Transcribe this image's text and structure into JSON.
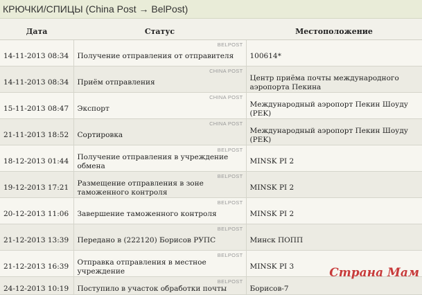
{
  "header": {
    "title": "КРЮЧКИ/СПИЦЫ (China Post → BelPost)"
  },
  "table": {
    "columns": [
      "Дата",
      "Статус",
      "Местоположение"
    ],
    "rows": [
      {
        "date": "14-11-2013 08:34",
        "service": "BELPOST",
        "status": "Получение отправления от отправителя",
        "location": "100614*"
      },
      {
        "date": "14-11-2013 08:34",
        "service": "CHINA POST",
        "status": "Приём отправления",
        "location": "Центр приёма почты международного аэропорта Пекина"
      },
      {
        "date": "15-11-2013 08:47",
        "service": "CHINA POST",
        "status": "Экспорт",
        "location": "Международный аэропорт Пекин Шоуду (PEK)"
      },
      {
        "date": "21-11-2013 18:52",
        "service": "CHINA POST",
        "status": "Сортировка",
        "location": "Международный аэропорт Пекин Шоуду (PEK)"
      },
      {
        "date": "18-12-2013 01:44",
        "service": "BELPOST",
        "status": "Получение отправления в учреждение обмена",
        "location": "MINSK PI 2"
      },
      {
        "date": "19-12-2013 17:21",
        "service": "BELPOST",
        "status": "Размещение отправления в зоне таможенного контроля",
        "location": "MINSK PI 2"
      },
      {
        "date": "20-12-2013 11:06",
        "service": "BELPOST",
        "status": "Завершение таможенного контроля",
        "location": "MINSK PI 2"
      },
      {
        "date": "21-12-2013 13:39",
        "service": "BELPOST",
        "status": "Передано в (222120) Борисов РУПС",
        "location": "Минск ПОПП"
      },
      {
        "date": "21-12-2013 16:39",
        "service": "BELPOST",
        "status": "Отправка отправления в местное учреждение",
        "location": "MINSK PI 3"
      },
      {
        "date": "24-12-2013 10:19",
        "service": "BELPOST",
        "status": "Поступило в участок обработки почты",
        "location": "Борисов-7"
      }
    ]
  },
  "watermark": {
    "text": "Страна Мам"
  }
}
